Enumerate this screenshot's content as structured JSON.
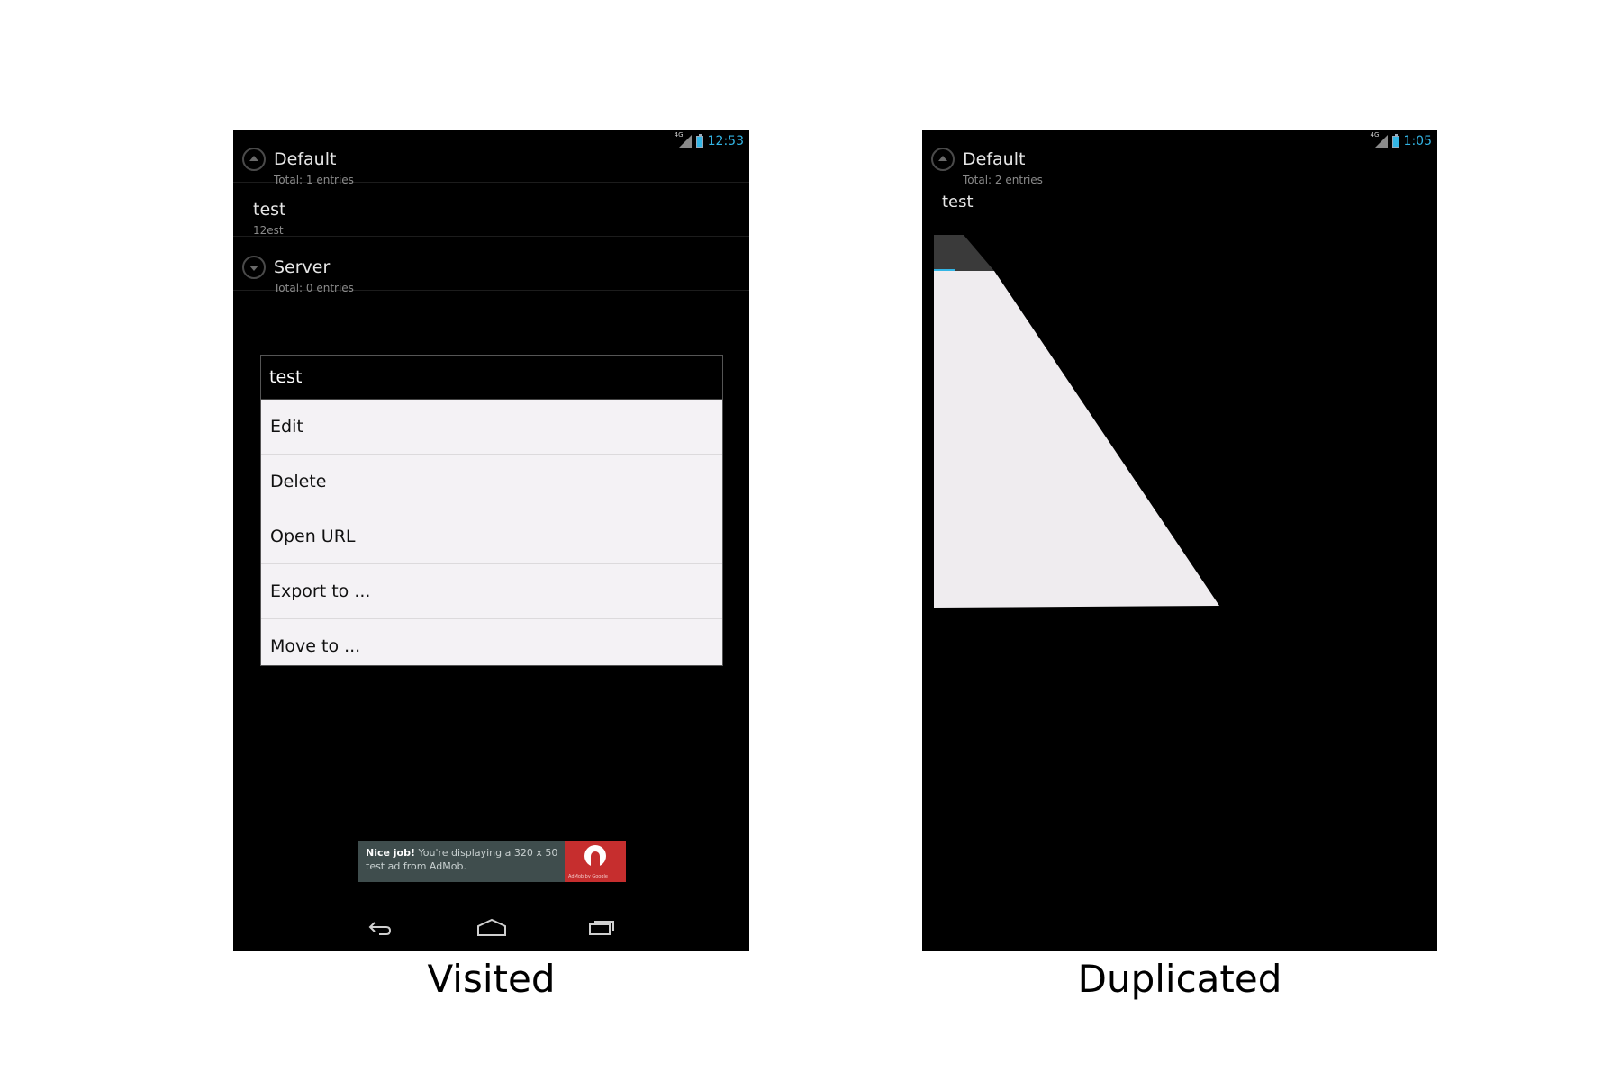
{
  "left_screen": {
    "status_time": "12:53",
    "signal_label": "4G",
    "groups": [
      {
        "title": "Default",
        "subtitle": "Total: 1 entries",
        "expanded": true
      },
      {
        "title": "Server",
        "subtitle": "Total: 0 entries",
        "expanded": false
      }
    ],
    "entry": {
      "title": "test",
      "subtitle": "12est"
    },
    "context_menu": {
      "title": "test",
      "items": [
        "Edit",
        "Delete",
        "Open URL",
        "Export to ...",
        "Move to ..."
      ]
    },
    "ad": {
      "bold": "Nice job!",
      "text": " You're displaying a 320 x 50 test ad from AdMob.",
      "logo_text": "AdMob by Google"
    },
    "caption": "Visited"
  },
  "right_screen": {
    "status_time": "1:05",
    "signal_label": "4G",
    "group": {
      "title": "Default",
      "subtitle": "Total: 2 entries"
    },
    "entry_title": "test",
    "caption": "Duplicated"
  },
  "colors": {
    "status_accent": "#33b5e5",
    "menu_background": "#f4f2f5",
    "ad_background": "#3f4d4d",
    "ad_logo": "#c62e2e"
  }
}
